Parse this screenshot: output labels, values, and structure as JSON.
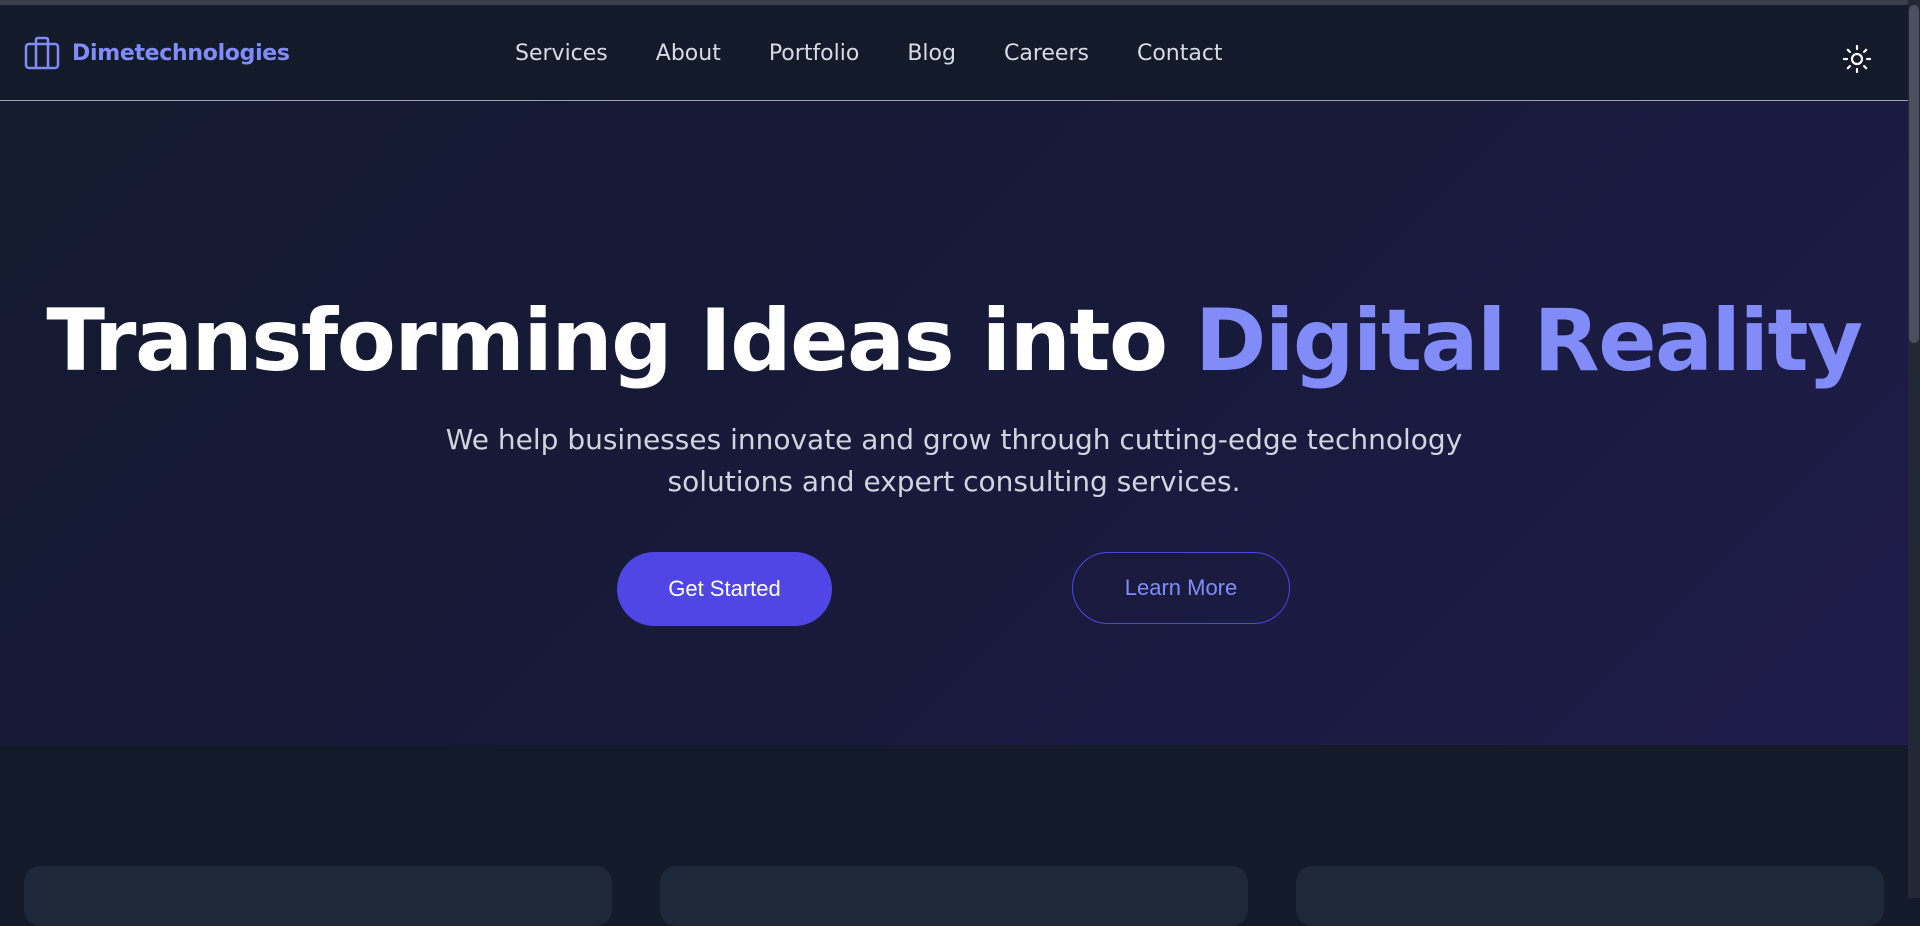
{
  "brand": {
    "name": "Dimetechnologies",
    "icon": "briefcase-icon"
  },
  "nav": {
    "items": [
      {
        "label": "Services"
      },
      {
        "label": "About"
      },
      {
        "label": "Portfolio"
      },
      {
        "label": "Blog"
      },
      {
        "label": "Careers"
      },
      {
        "label": "Contact"
      }
    ]
  },
  "theme_toggle": {
    "icon": "sun-icon"
  },
  "hero": {
    "title_main": "Transforming Ideas into ",
    "title_accent": "Digital Reality",
    "subtitle_line1": "We help businesses innovate and grow through cutting-edge technology",
    "subtitle_line2": "solutions and expert consulting services.",
    "primary_button": "Get Started",
    "secondary_button": "Learn More"
  },
  "colors": {
    "accent": "#818cf8",
    "primary": "#4f46e5",
    "background": "#131a2a",
    "card": "#1f2838"
  }
}
